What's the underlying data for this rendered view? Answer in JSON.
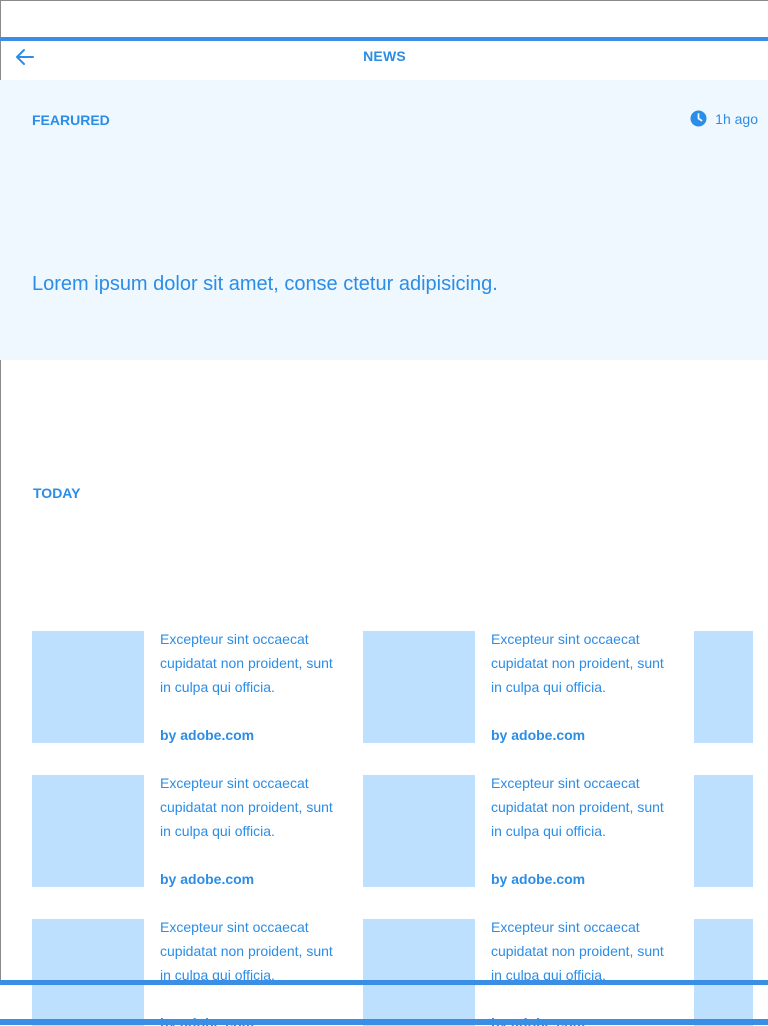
{
  "header": {
    "title": "NEWS",
    "back_icon": "arrow-left-icon"
  },
  "featured": {
    "label": "FEARURED",
    "time": "1h ago",
    "time_icon": "clock-icon",
    "headline": "Lorem ipsum dolor sit amet, conse ctetur adipisicing."
  },
  "today": {
    "label": "TODAY",
    "articles": [
      {
        "text": "Excepteur sint occaecat cupidatat non proident, sunt in culpa qui officia.",
        "source": "by adobe.com"
      },
      {
        "text": "Excepteur sint occaecat cupidatat non proident, sunt in culpa qui officia.",
        "source": "by adobe.com"
      },
      {
        "text": "Excepteur sint occaecat cupidatat non proident, sunt in culpa qui officia.",
        "source": "by adobe.com"
      },
      {
        "text": "Excepteur sint occaecat cupidatat non proident, sunt in culpa qui officia.",
        "source": "by adobe.com"
      },
      {
        "text": "Excepteur sint occaecat cupidatat non proident, sunt in culpa qui officia.",
        "source": "by adobe.com"
      },
      {
        "text": "Excepteur sint occaecat cupidatat non proident, sunt in culpa qui officia.",
        "source": "by adobe.com"
      }
    ]
  },
  "colors": {
    "accent": "#2b8de6",
    "bar": "#3a8ee6",
    "featured_bg": "#eff7ff",
    "thumb": "#bde0fe"
  }
}
